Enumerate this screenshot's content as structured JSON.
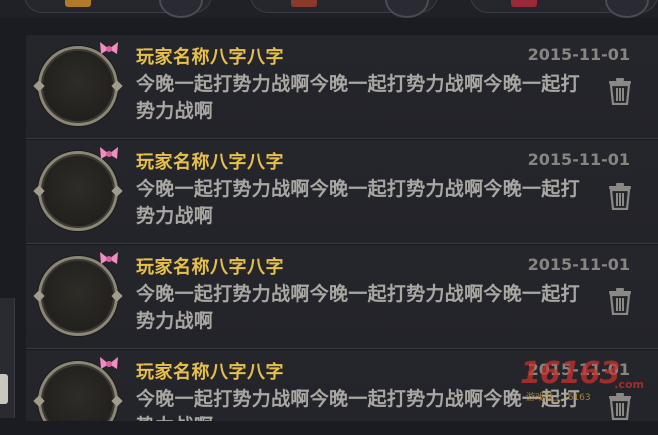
{
  "colors": {
    "name": "#e7c04b",
    "message": "#a8a7a1",
    "date": "#86857f",
    "row_bg": "#24252b",
    "bow": "#f08fbf"
  },
  "messages": [
    {
      "player_name": "玩家名称八字八字",
      "date": "2015-11-01",
      "text": "今晚一起打势力战啊今晚一起打势力战啊今晚一起打势力战啊",
      "avatar_icon": "avatar-frame-icon",
      "badge_icon": "pink-bow-icon",
      "action_icon": "trash-icon"
    },
    {
      "player_name": "玩家名称八字八字",
      "date": "2015-11-01",
      "text": "今晚一起打势力战啊今晚一起打势力战啊今晚一起打势力战啊",
      "avatar_icon": "avatar-frame-icon",
      "badge_icon": "pink-bow-icon",
      "action_icon": "trash-icon"
    },
    {
      "player_name": "玩家名称八字八字",
      "date": "2015-11-01",
      "text": "今晚一起打势力战啊今晚一起打势力战啊今晚一起打势力战啊",
      "avatar_icon": "avatar-frame-icon",
      "badge_icon": "pink-bow-icon",
      "action_icon": "trash-icon"
    },
    {
      "player_name": "玩家名称八字八字",
      "date": "2015-11-01",
      "text": "今晚一起打势力战啊今晚一起打势力战啊今晚一起打势力战啊",
      "avatar_icon": "avatar-frame-icon",
      "badge_icon": "pink-bow-icon",
      "action_icon": "trash-icon"
    }
  ],
  "watermark": {
    "logo": "16163",
    "suffix": ".com",
    "tagline": "游戏就上16163"
  }
}
